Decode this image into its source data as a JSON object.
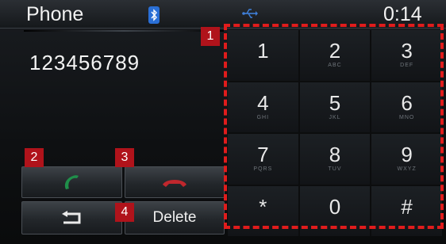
{
  "status_bar": {
    "title": "Phone",
    "bluetooth_icon": "bluetooth-icon",
    "usb_icon": "usb-icon",
    "time": "0:14"
  },
  "display": {
    "dialed_number": "123456789"
  },
  "actions": {
    "call_icon": "phone-call-icon",
    "end_icon": "phone-end-icon",
    "back_icon": "back-arrow-icon",
    "delete_label": "Delete"
  },
  "keypad": {
    "keys": [
      {
        "digit": "1",
        "letters": ""
      },
      {
        "digit": "2",
        "letters": "ABC"
      },
      {
        "digit": "3",
        "letters": "DEF"
      },
      {
        "digit": "4",
        "letters": "GHI"
      },
      {
        "digit": "5",
        "letters": "JKL"
      },
      {
        "digit": "6",
        "letters": "MNO"
      },
      {
        "digit": "7",
        "letters": "PQRS"
      },
      {
        "digit": "8",
        "letters": "TUV"
      },
      {
        "digit": "9",
        "letters": "WXYZ"
      },
      {
        "digit": "*",
        "letters": ""
      },
      {
        "digit": "0",
        "letters": ""
      },
      {
        "digit": "#",
        "letters": ""
      }
    ]
  },
  "annotations": {
    "callouts": [
      "1",
      "2",
      "3",
      "4"
    ]
  },
  "colors": {
    "call_green": "#1f8f4a",
    "end_red": "#c0272d",
    "annotation_red": "#e01c1c"
  }
}
